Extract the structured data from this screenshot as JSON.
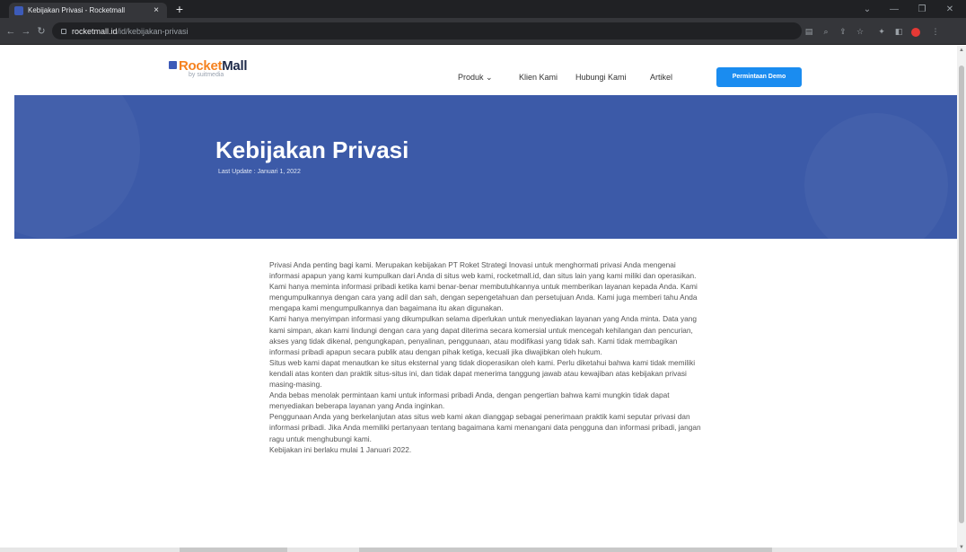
{
  "browser": {
    "tab_title": "Kebijakan Privasi - Rocketmall",
    "tab_close": "×",
    "new_tab": "+",
    "url_host": "rocketmall.id",
    "url_path": "/id/kebijakan-privasi"
  },
  "header": {
    "logo_rocket": "Rocket",
    "logo_mall": "Mall",
    "logo_sub": "by suitmedia",
    "nav": [
      {
        "label": "Produk ⌄"
      },
      {
        "label": "Klien Kami"
      },
      {
        "label": "Hubungi Kami"
      },
      {
        "label": "Artikel"
      }
    ],
    "demo_button": "Permintaan Demo"
  },
  "hero": {
    "title": "Kebijakan Privasi",
    "last_update": "Last Update : Januari 1, 2022"
  },
  "content": {
    "paragraphs": [
      "Privasi Anda penting bagi kami. Merupakan kebijakan PT Roket Strategi Inovasi untuk menghormati privasi Anda mengenai informasi apapun yang kami kumpulkan dari Anda di situs web kami, rocketmall.id, dan situs lain yang kami miliki dan operasikan.",
      "Kami hanya meminta informasi pribadi ketika kami benar-benar membutuhkannya untuk memberikan layanan kepada Anda. Kami mengumpulkannya dengan cara yang adil dan sah, dengan sepengetahuan dan persetujuan Anda. Kami juga memberi tahu Anda mengapa kami mengumpulkannya dan bagaimana itu akan digunakan.",
      "Kami hanya menyimpan informasi yang dikumpulkan selama diperlukan untuk menyediakan layanan yang Anda minta. Data yang kami simpan, akan kami lindungi dengan cara yang dapat diterima secara komersial untuk mencegah kehilangan dan pencurian, akses yang tidak dikenal, pengungkapan, penyalinan, penggunaan, atau modifikasi yang tidak sah. Kami tidak membagikan informasi pribadi apapun secara publik atau dengan pihak ketiga, kecuali jika diwajibkan oleh hukum.",
      "Situs web kami dapat menautkan ke situs eksternal yang tidak dioperasikan oleh kami. Perlu diketahui bahwa kami tidak memiliki kendali atas konten dan praktik situs-situs ini, dan tidak dapat menerima tanggung jawab atau kewajiban atas kebijakan privasi masing-masing.",
      "Anda bebas menolak permintaan kami untuk informasi pribadi Anda, dengan pengertian bahwa kami mungkin tidak dapat menyediakan beberapa layanan yang Anda inginkan.",
      "Penggunaan Anda yang berkelanjutan atas situs web kami akan dianggap sebagai penerimaan praktik kami seputar privasi dan informasi pribadi. Jika Anda memiliki pertanyaan tentang bagaimana kami menangani data pengguna dan informasi pribadi, jangan ragu untuk menghubungi kami.",
      "Kebijakan ini berlaku mulai 1 Januari 2022."
    ]
  }
}
